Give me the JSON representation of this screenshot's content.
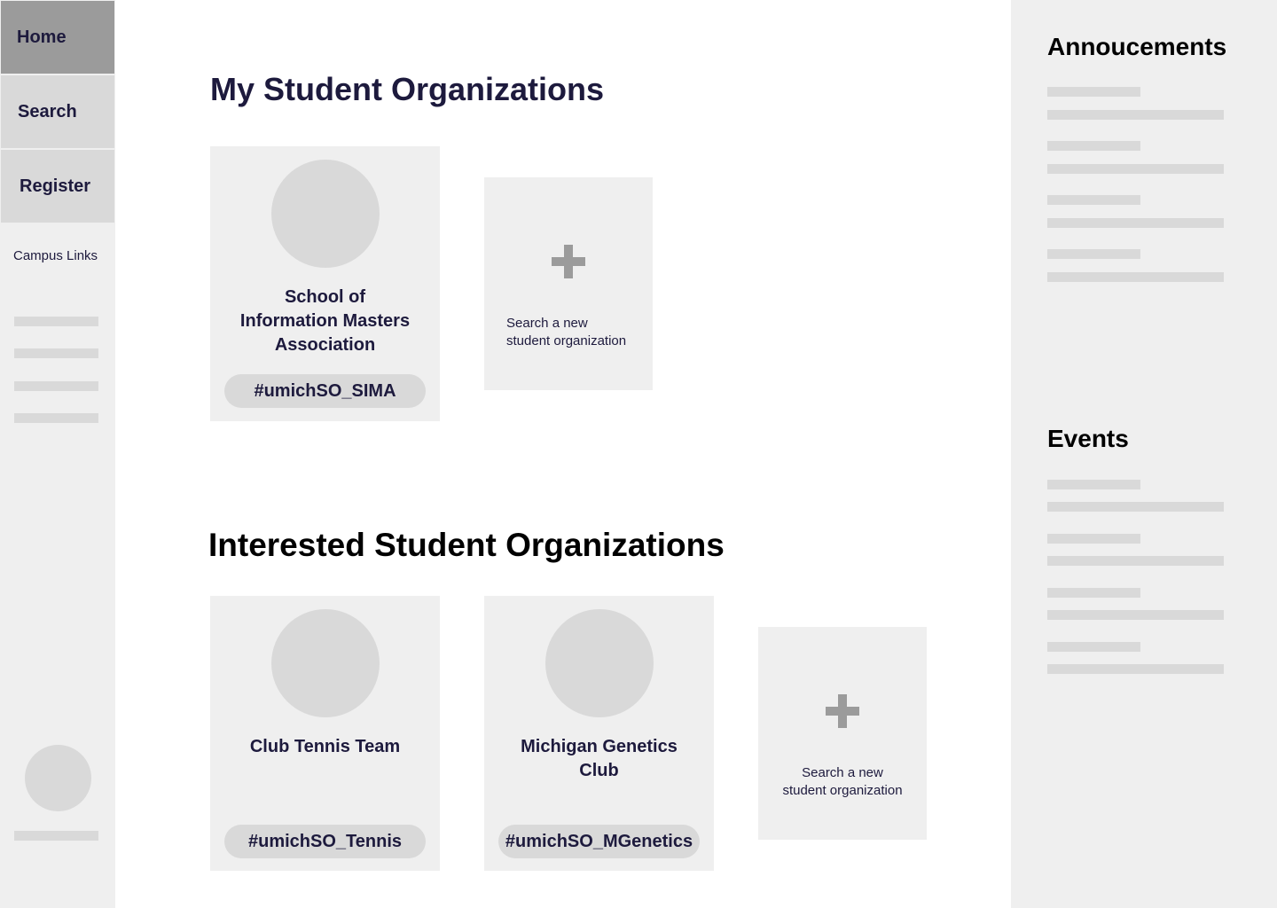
{
  "sidebar": {
    "nav": [
      {
        "label": "Home"
      },
      {
        "label": "Search"
      },
      {
        "label": "Register"
      }
    ],
    "campus_links_label": "Campus Links"
  },
  "main": {
    "my_orgs": {
      "title": "My Student Organizations",
      "cards": [
        {
          "name_lines": [
            "School of",
            "Information Masters",
            "Association"
          ],
          "tag": "#umichSO_SIMA"
        }
      ],
      "add_card": {
        "line1": "Search a new",
        "line2": "student organization"
      }
    },
    "interested_orgs": {
      "title": "Interested Student Organizations",
      "cards": [
        {
          "name_lines": [
            "Club Tennis Team"
          ],
          "tag": "#umichSO_Tennis"
        },
        {
          "name_lines": [
            "Michigan Genetics",
            "Club"
          ],
          "tag": "#umichSO_MGenetics"
        }
      ],
      "add_card": {
        "line1": "Search a new",
        "line2": "student organization"
      }
    }
  },
  "right_panel": {
    "announcements_title": "Annoucements",
    "events_title": "Events"
  },
  "colors": {
    "text_primary": "#1d1a3d",
    "panel_bg": "#efefef",
    "placeholder": "#d9d9d9",
    "active_nav": "#9b9b9b"
  }
}
